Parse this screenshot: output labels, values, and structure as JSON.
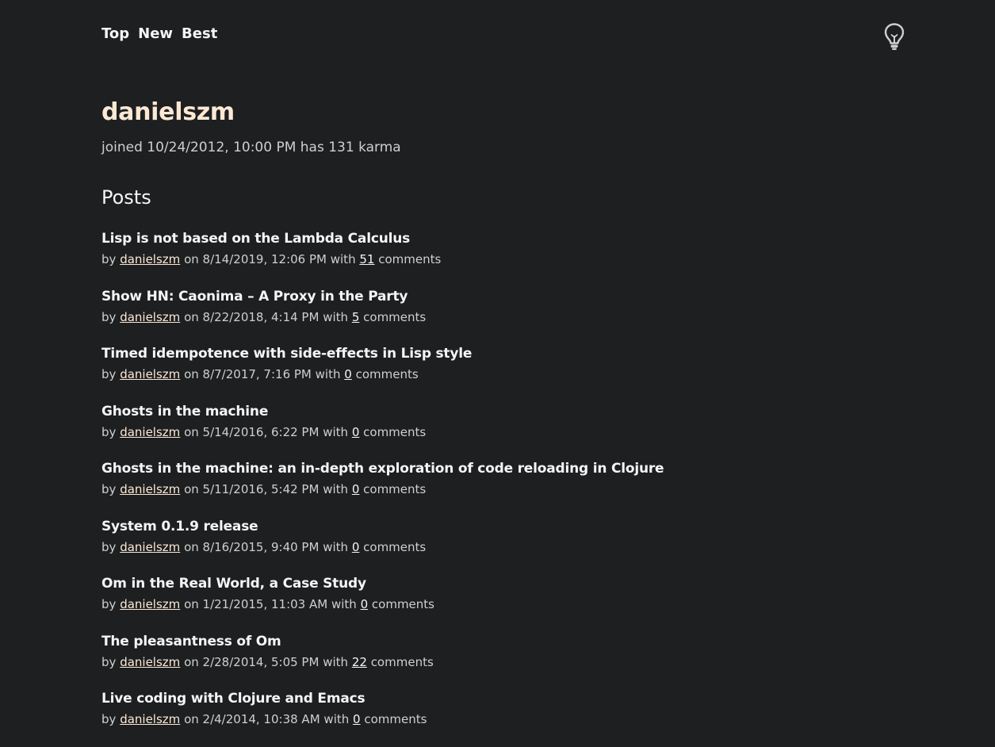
{
  "nav": {
    "items": [
      {
        "label": "Top"
      },
      {
        "label": "New"
      },
      {
        "label": "Best"
      }
    ]
  },
  "profile": {
    "username": "danielszm",
    "joined_text": "joined 10/24/2012, 10:00 PM has 131 karma"
  },
  "posts_section": {
    "title": "Posts",
    "by_word": "by",
    "on_word": "on",
    "with_word": "with",
    "comments_word": "comments",
    "items": [
      {
        "title": "Lisp is not based on the Lambda Calculus",
        "author": "danielszm",
        "date": "8/14/2019, 12:06 PM",
        "comments": "51"
      },
      {
        "title": "Show HN: Caonima – A Proxy in the Party",
        "author": "danielszm",
        "date": "8/22/2018, 4:14 PM",
        "comments": "5"
      },
      {
        "title": "Timed idempotence with side-effects in Lisp style",
        "author": "danielszm",
        "date": "8/7/2017, 7:16 PM",
        "comments": "0"
      },
      {
        "title": "Ghosts in the machine",
        "author": "danielszm",
        "date": "5/14/2016, 6:22 PM",
        "comments": "0"
      },
      {
        "title": "Ghosts in the machine: an in-depth exploration of code reloading in Clojure",
        "author": "danielszm",
        "date": "5/11/2016, 5:42 PM",
        "comments": "0"
      },
      {
        "title": "System 0.1.9 release",
        "author": "danielszm",
        "date": "8/16/2015, 9:40 PM",
        "comments": "0"
      },
      {
        "title": "Om in the Real World, a Case Study",
        "author": "danielszm",
        "date": "1/21/2015, 11:03 AM",
        "comments": "0"
      },
      {
        "title": "The pleasantness of Om",
        "author": "danielszm",
        "date": "2/28/2014, 5:05 PM",
        "comments": "22"
      },
      {
        "title": "Live coding with Clojure and Emacs",
        "author": "danielszm",
        "date": "2/4/2014, 10:38 AM",
        "comments": "0"
      }
    ]
  },
  "theme_toggle": {
    "icon": "lightbulb-icon"
  },
  "colors": {
    "background": "#1d1f21",
    "accent": "#fde9d3",
    "text": "#f5f5f5",
    "muted": "#cfcfcf"
  }
}
